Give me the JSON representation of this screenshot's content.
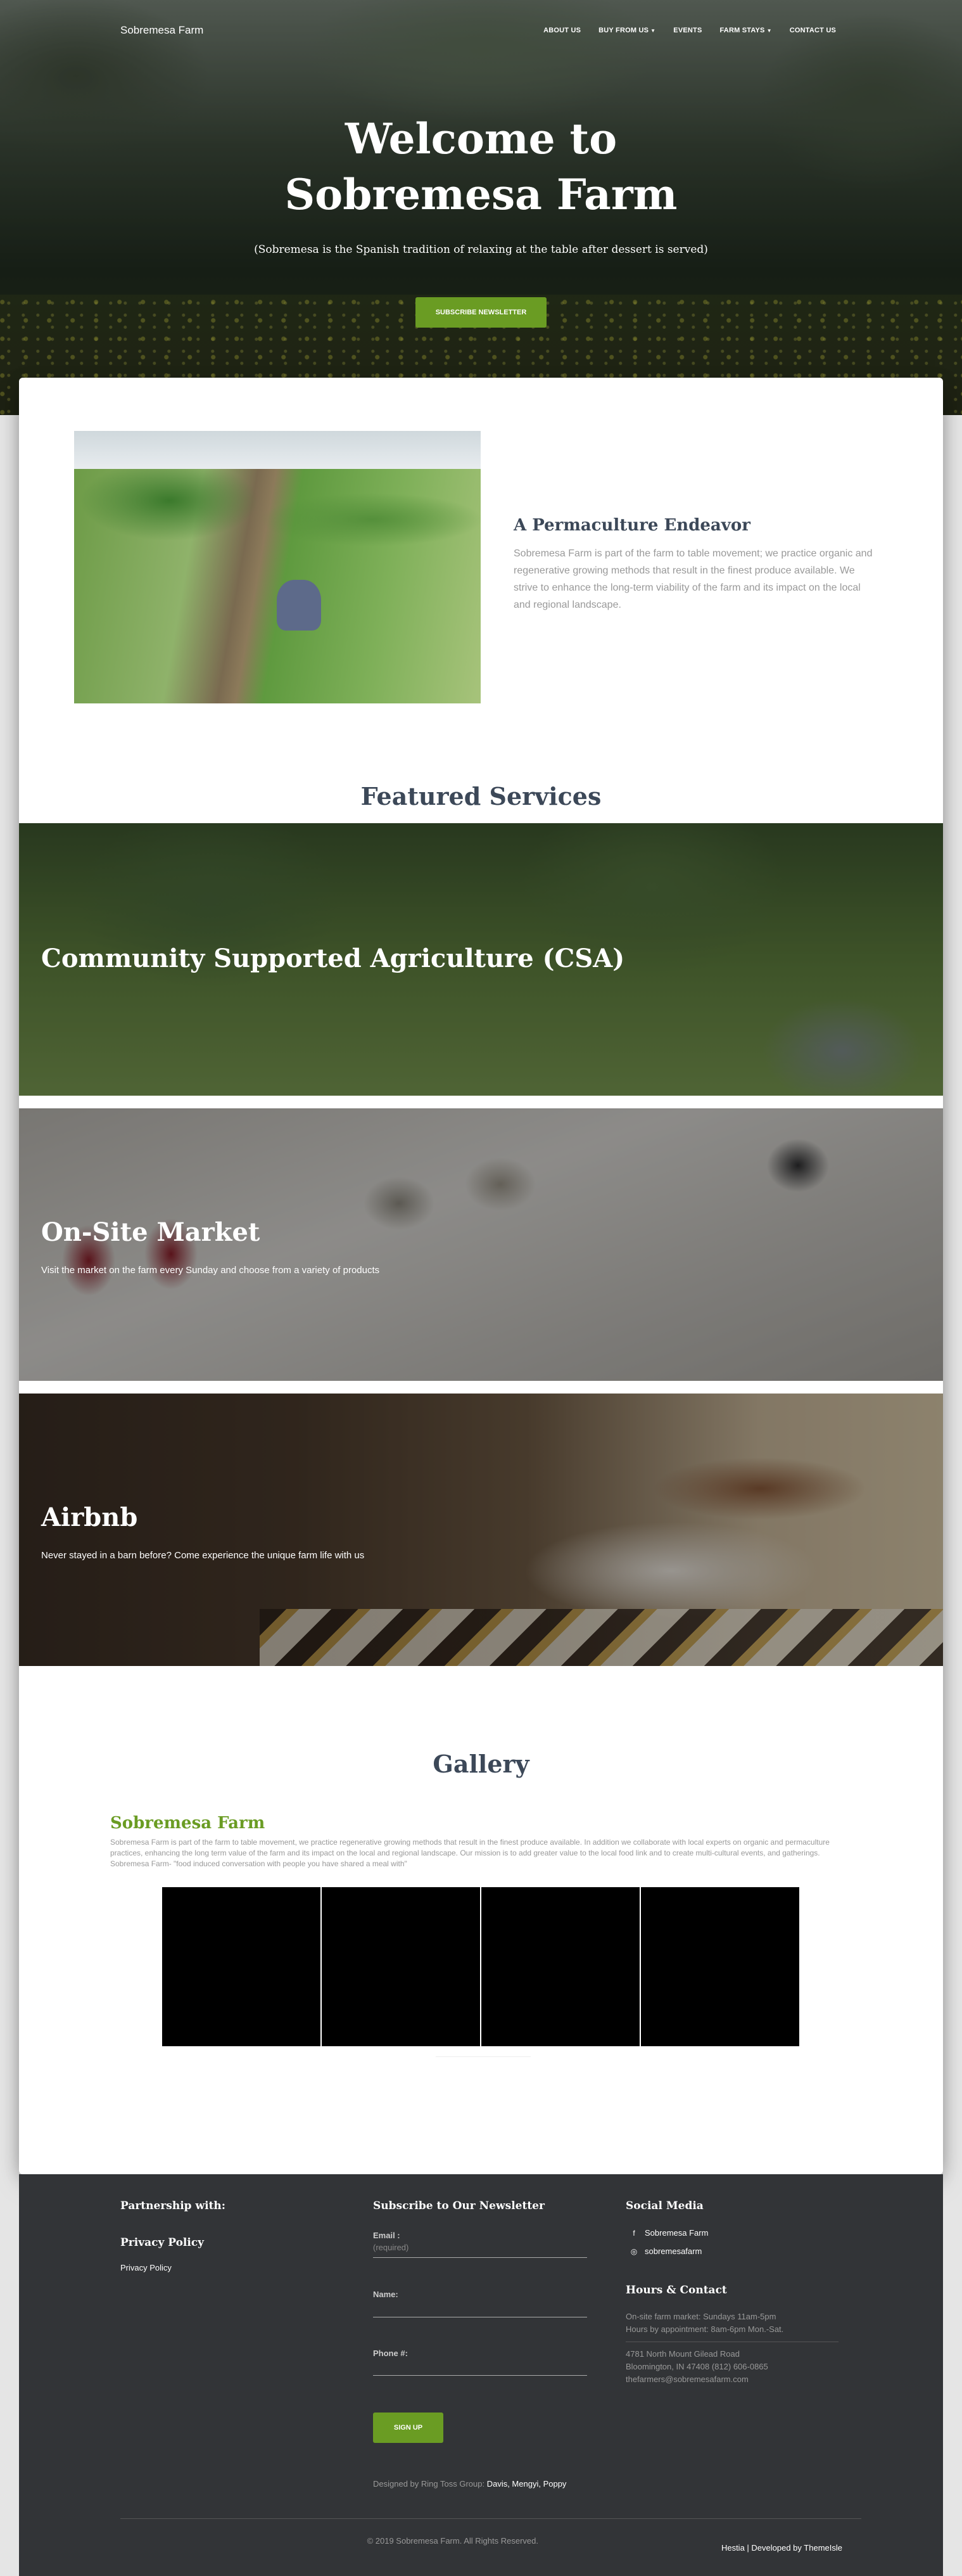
{
  "colors": {
    "accent": "#6a9c23",
    "heading": "#3c4858",
    "footer_bg": "#323437"
  },
  "nav": {
    "brand": "Sobremesa Farm",
    "items": [
      {
        "label": "ABOUT US",
        "dropdown": false
      },
      {
        "label": "BUY FROM US",
        "dropdown": true
      },
      {
        "label": "EVENTS",
        "dropdown": false
      },
      {
        "label": "FARM STAYS",
        "dropdown": true
      },
      {
        "label": "CONTACT US",
        "dropdown": false
      }
    ]
  },
  "hero": {
    "title_line1": "Welcome to",
    "title_line2": "Sobremesa Farm",
    "subtitle": "(Sobremesa is the Spanish tradition of relaxing at the table after dessert is served)",
    "button": "SUBSCRIBE NEWSLETTER"
  },
  "about": {
    "title": "A Permaculture Endeavor",
    "text": "Sobremesa Farm is part of the farm to table movement; we practice organic and regenerative growing methods that result in the finest produce available. We strive to enhance the long-term viability of the farm and its impact on the local and regional landscape."
  },
  "services": {
    "title": "Featured Services",
    "items": [
      {
        "title": "Community Supported Agriculture (CSA)",
        "text": ""
      },
      {
        "title": "On-Site Market",
        "text": "Visit the market on the farm every Sunday and choose from a variety of products"
      },
      {
        "title": "Airbnb",
        "text": "Never stayed in a barn before? Come experience the unique farm life with us"
      }
    ]
  },
  "gallery": {
    "title": "Gallery",
    "subtitle": "Sobremesa Farm",
    "text": "Sobremesa Farm is part of the farm to table movement, we practice regenerative growing methods that result in the finest produce available. In addition we collaborate with local experts on organic and permaculture practices, enhancing the long term value of the farm and its impact on the local and regional landscape. Our mission is to add greater value to the local food link and to create multi-cultural events, and gatherings. Sobremesa Farm- \"food induced conversation with people you have shared a meal with\""
  },
  "footer": {
    "col1": {
      "title": "Partnership with:",
      "privacy_title": "Privacy Policy",
      "privacy_link": "Privacy Policy"
    },
    "newsletter": {
      "title": "Subscribe to Our Newsletter",
      "email_label": "Email :",
      "email_placeholder": "(required)",
      "name_label": "Name:",
      "phone_label": "Phone #:",
      "button": "SIGN UP",
      "designed_prefix": "Designed by Ring Toss Group:",
      "designed_names": "Davis, Mengyi, Poppy"
    },
    "social": {
      "title": "Social Media",
      "facebook": "Sobremesa Farm",
      "instagram": "sobremesafarm",
      "facebook_icon": "facebook-icon",
      "instagram_icon": "instagram-icon"
    },
    "hours": {
      "title": "Hours & Contact",
      "line1": "On-site farm market: Sundays 11am-5pm",
      "line2": "Hours by appointment: 8am-6pm Mon.-Sat.",
      "address1": "4781 North Mount Gilead Road",
      "address2": "Bloomington, IN 47408 (812) 606-0865",
      "email": "thefarmers@sobremesafarm.com"
    },
    "copyright": "© 2019 Sobremesa Farm. All Rights Reserved.",
    "credit_hestia": "Hestia",
    "credit_sep": " | Developed by ",
    "credit_themeisle": "ThemeIsle"
  }
}
